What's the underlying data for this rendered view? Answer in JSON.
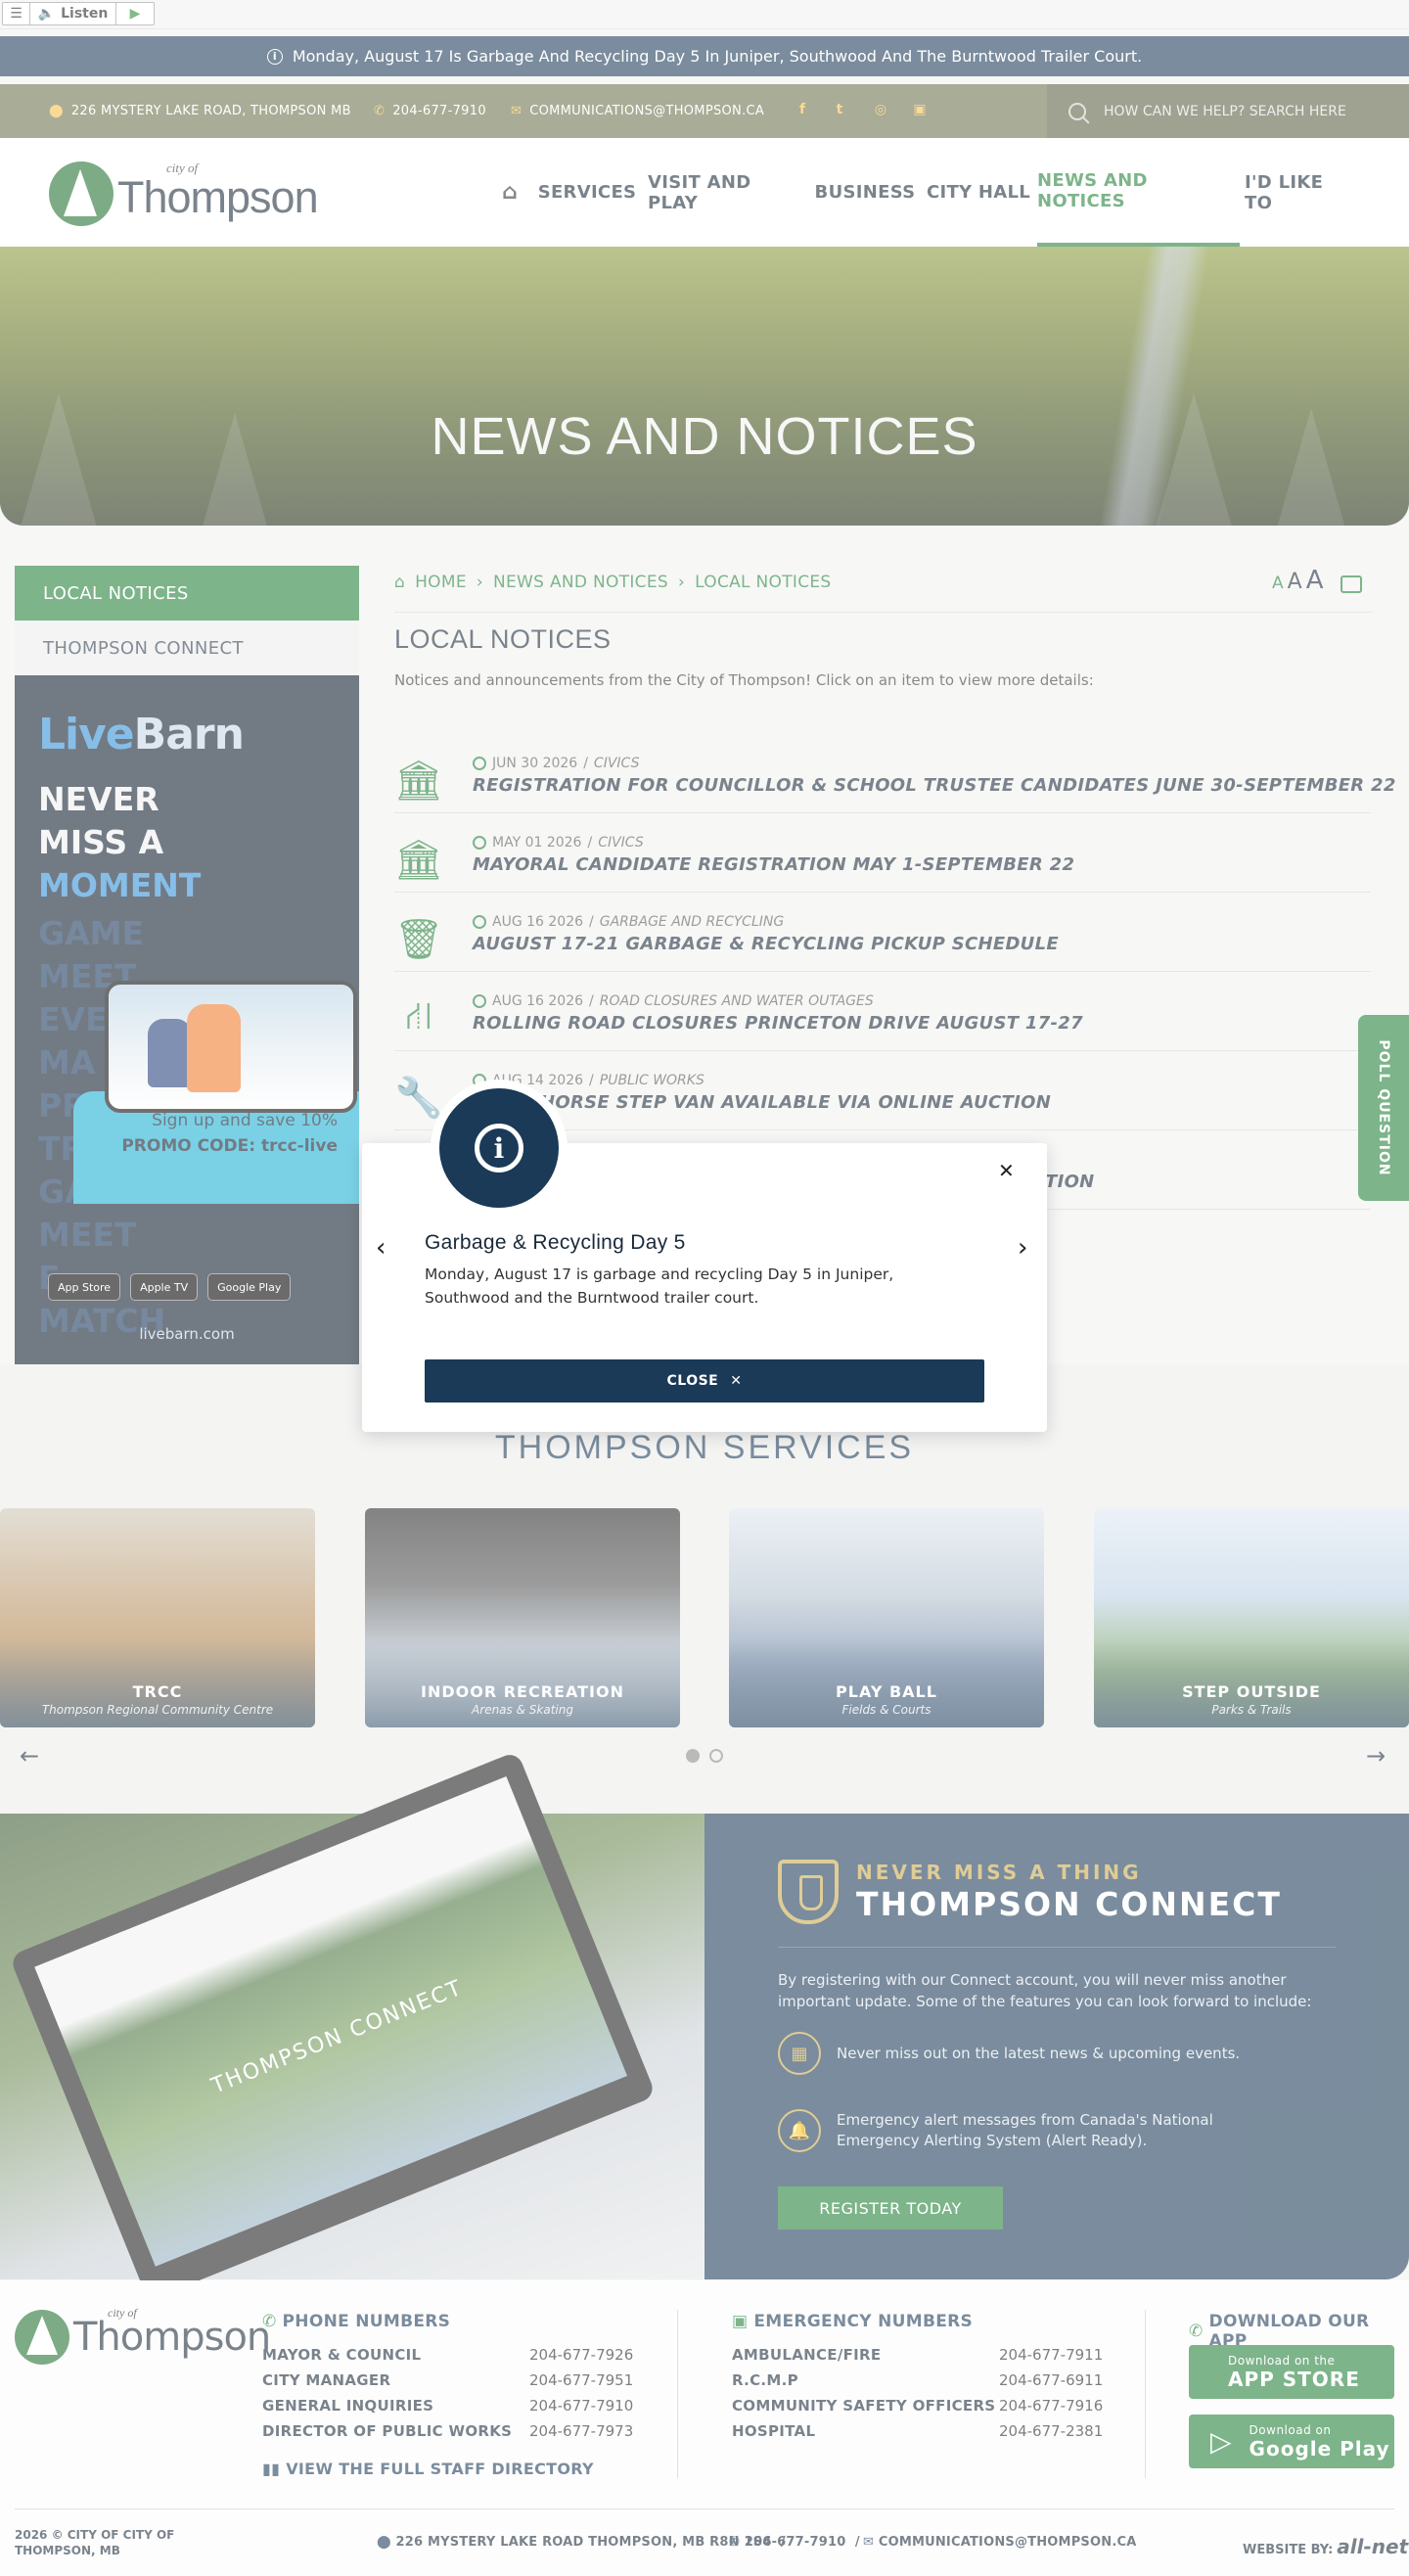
{
  "listen": {
    "label": "Listen"
  },
  "alert": {
    "text": "Monday, August 17 Is Garbage And Recycling Day 5 In Juniper, Southwood And The Burntwood Trailer Court."
  },
  "contact": {
    "address": "226 MYSTERY LAKE ROAD, THOMPSON MB",
    "phone": "204-677-7910",
    "email": "COMMUNICATIONS@THOMPSON.CA",
    "search_placeholder": "HOW CAN WE HELP? SEARCH HERE"
  },
  "logo": {
    "small": "city of",
    "name": "Thompson"
  },
  "nav": {
    "items": [
      "SERVICES",
      "VISIT AND PLAY",
      "BUSINESS",
      "CITY HALL",
      "NEWS AND NOTICES",
      "I'D LIKE TO"
    ],
    "active": "NEWS AND NOTICES"
  },
  "hero": {
    "title": "NEWS AND NOTICES"
  },
  "sidenav": {
    "items": [
      "LOCAL NOTICES",
      "THOMPSON CONNECT"
    ]
  },
  "ad": {
    "brand1": "Live",
    "brand2": "Barn",
    "line1": "NEVER",
    "line2": "MISS A",
    "line3": "MOMENT",
    "faded": [
      "GAME",
      "MEET",
      "EVE",
      "MA",
      "PR",
      "TR",
      "GA",
      "MEET",
      "E",
      "MATCH"
    ],
    "promo1": "Sign up and save 10%",
    "promo2": "PROMO CODE: trcc-live",
    "badges": [
      "App Store",
      "Apple TV",
      "Google Play"
    ],
    "site": "livebarn.com"
  },
  "breadcrumb": {
    "home": "HOME",
    "section": "NEWS AND NOTICES",
    "current": "LOCAL NOTICES"
  },
  "font_sizer": {
    "a": "A"
  },
  "page": {
    "title": "LOCAL NOTICES",
    "intro": "Notices and announcements from the City of Thompson! Click on an item to view more details:"
  },
  "notices": [
    {
      "date": "JUN 30 2026",
      "category": "CIVICS",
      "title": "REGISTRATION FOR COUNCILLOR & SCHOOL TRUSTEE CANDIDATES JUNE 30-SEPTEMBER 22",
      "icon": "building-icon"
    },
    {
      "date": "MAY 01 2026",
      "category": "CIVICS",
      "title": "MAYORAL CANDIDATE REGISTRATION MAY 1-SEPTEMBER 22",
      "icon": "building-icon"
    },
    {
      "date": "AUG 16 2026",
      "category": "GARBAGE AND RECYCLING",
      "title": "AUGUST 17-21 GARBAGE & RECYCLING PICKUP SCHEDULE",
      "icon": "trash-icon"
    },
    {
      "date": "AUG 16 2026",
      "category": "ROAD CLOSURES AND WATER OUTAGES",
      "title": "ROLLING ROAD CLOSURES PRINCETON DRIVE AUGUST 17-27",
      "icon": "road-icon"
    },
    {
      "date": "AUG 14 2026",
      "category": "PUBLIC WORKS",
      "title": "ORKHORSE STEP VAN AVAILABLE VIA ONLINE AUCTION",
      "icon": "wrench-icon"
    },
    {
      "date": "",
      "category": "",
      "title": "TION",
      "icon": "wrench-icon"
    }
  ],
  "poll": {
    "label": "POLL QUESTION"
  },
  "services": {
    "title": "THOMPSON SERVICES",
    "cards": [
      {
        "title": "TRCC",
        "subtitle": "Thompson Regional Community Centre"
      },
      {
        "title": "INDOOR RECREATION",
        "subtitle": "Arenas & Skating"
      },
      {
        "title": "PLAY BALL",
        "subtitle": "Fields & Courts"
      },
      {
        "title": "STEP OUTSIDE",
        "subtitle": "Parks & Trails"
      }
    ]
  },
  "connect": {
    "kicker": "NEVER MISS A THING",
    "title": "THOMPSON CONNECT",
    "desc": "By registering with our Connect account, you will never miss another important update. Some of the features you can look forward to include:",
    "features": [
      "Never miss out on the latest news & upcoming events.",
      "Emergency alert messages from Canada's National Emergency Alerting System (Alert Ready)."
    ],
    "register": "REGISTER TODAY",
    "laptop_caption": "THOMPSON CONNECT"
  },
  "footer": {
    "phone_heading": "PHONE NUMBERS",
    "phones": [
      {
        "label": "MAYOR & COUNCIL",
        "number": "204-677-7926"
      },
      {
        "label": "CITY MANAGER",
        "number": "204-677-7951"
      },
      {
        "label": "GENERAL INQUIRIES",
        "number": "204-677-7910"
      },
      {
        "label": "DIRECTOR OF PUBLIC WORKS",
        "number": "204-677-7973"
      }
    ],
    "staff_link": "VIEW THE FULL STAFF DIRECTORY",
    "emergency_heading": "EMERGENCY NUMBERS",
    "emergency": [
      {
        "label": "AMBULANCE/FIRE",
        "number": "204-677-7911"
      },
      {
        "label": "R.C.M.P",
        "number": "204-677-6911"
      },
      {
        "label": "COMMUNITY SAFETY OFFICERS",
        "number": "204-677-7916"
      },
      {
        "label": "HOSPITAL",
        "number": "204-677-2381"
      }
    ],
    "app_heading": "DOWNLOAD OUR APP",
    "app_store_small": "Download on the",
    "app_store": "APP STORE",
    "google_small": "Download on",
    "google": "Google Play",
    "copyright": "2026 © CITY OF CITY OF THOMPSON, MB",
    "address": "226 MYSTERY LAKE ROAD THOMPSON, MB R8N 1S6",
    "phone": "204-677-7910",
    "email": "COMMUNICATIONS@THOMPSON.CA",
    "website_by": "WEBSITE BY:",
    "agency": "all-net"
  },
  "modal": {
    "title": "Garbage & Recycling Day 5",
    "body": "Monday, August 17 is garbage and recycling Day 5 in Juniper, Southwood and the Burntwood trailer court.",
    "close": "CLOSE"
  },
  "colors": {
    "brand_green": "#1f7f36",
    "navy": "#1a3a57",
    "gold": "#c9a84b"
  }
}
